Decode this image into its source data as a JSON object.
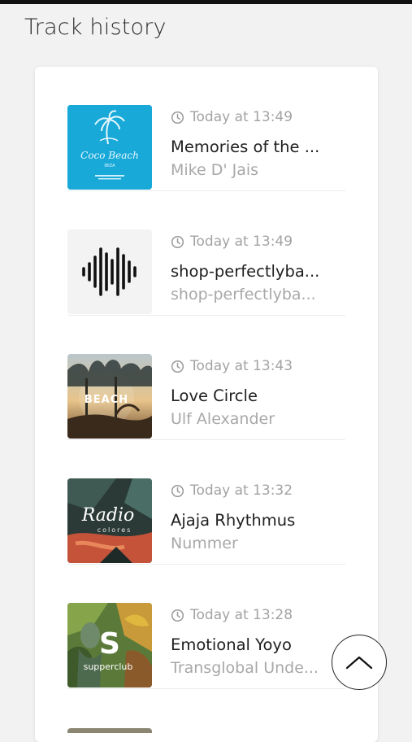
{
  "page": {
    "title": "Track history"
  },
  "colors": {
    "accent": "#16a8d6",
    "muted": "#a3a3a3",
    "text": "#1f1f1f"
  },
  "tracks": [
    {
      "time": "Today at 13:49",
      "title": "Memories of the ...",
      "artist": "Mike D' Jais",
      "art_icon": "coco-beach-cover",
      "art_text": [
        "Coco Beach",
        "IBIZA"
      ]
    },
    {
      "time": "Today at 13:49",
      "title": "shop-perfectlyba...",
      "artist": "shop-perfectlyba...",
      "art_icon": "waveform-icon"
    },
    {
      "time": "Today at 13:43",
      "title": "Love Circle",
      "artist": "Ulf Alexander",
      "art_icon": "beach-cover",
      "art_text": [
        "BEACH"
      ]
    },
    {
      "time": "Today at 13:32",
      "title": "Ajaja Rhythmus",
      "artist": "Nummer",
      "art_icon": "radio-cover",
      "art_text": [
        "Radio",
        "colores"
      ]
    },
    {
      "time": "Today at 13:28",
      "title": "Emotional Yoyo",
      "artist": "Transglobal Unde...",
      "art_icon": "supperclub-cover",
      "art_text": [
        "S",
        "supperclub"
      ]
    }
  ],
  "scroll_top": {
    "icon": "chevron-up-icon"
  }
}
